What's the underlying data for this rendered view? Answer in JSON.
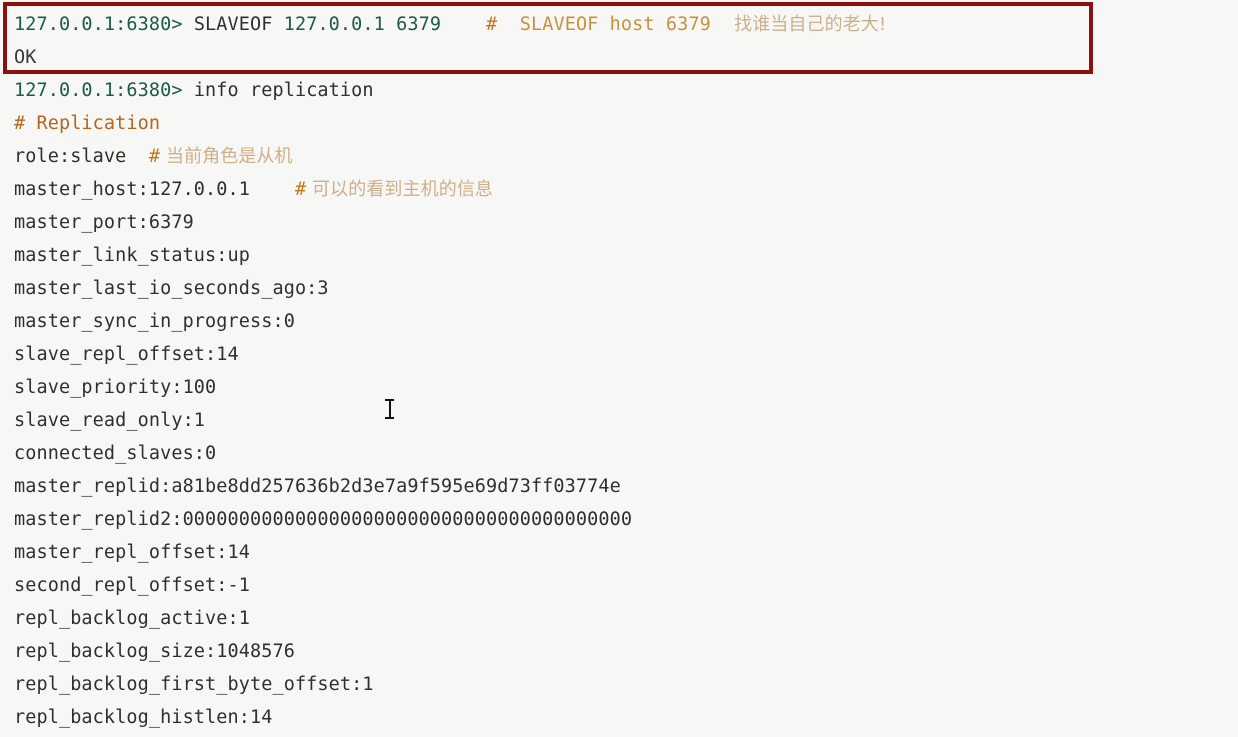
{
  "terminal": {
    "background_color": "#f7f7f5",
    "highlight_box_color": "#8b1111",
    "prompt_color": "#1d5c43",
    "comment_color": "#c8913f",
    "section_color": "#b5651d",
    "cursor_icon": "i-beam-text-cursor"
  },
  "highlighted_block": {
    "command_line": {
      "prompt": "127.0.0.1:6380>",
      "command": " SLAVEOF ",
      "args": "127.0.0.1 6379",
      "gap": "    ",
      "comment_hash": "#",
      "comment_en": "  SLAVEOF host 6379",
      "comment_cn": "    找谁当自己的老大!"
    },
    "reply": "OK"
  },
  "info_command": {
    "prompt": "127.0.0.1:6380>",
    "command": " info replication"
  },
  "section_header": "# Replication",
  "info_lines": [
    {
      "text": "role:slave",
      "gap": "  ",
      "hash": "#",
      "comment_cn": " 当前角色是从机"
    },
    {
      "text": "master_host:127.0.0.1",
      "gap": "    ",
      "hash": "#",
      "comment_cn": " 可以的看到主机的信息"
    },
    {
      "text": "master_port:6379"
    },
    {
      "text": "master_link_status:up"
    },
    {
      "text": "master_last_io_seconds_ago:3"
    },
    {
      "text": "master_sync_in_progress:0"
    },
    {
      "text": "slave_repl_offset:14"
    },
    {
      "text": "slave_priority:100"
    },
    {
      "text": "slave_read_only:1"
    },
    {
      "text": "connected_slaves:0"
    },
    {
      "text": "master_replid:a81be8dd257636b2d3e7a9f595e69d73ff03774e"
    },
    {
      "text": "master_replid2:0000000000000000000000000000000000000000"
    },
    {
      "text": "master_repl_offset:14"
    },
    {
      "text": "second_repl_offset:-1"
    },
    {
      "text": "repl_backlog_active:1"
    },
    {
      "text": "repl_backlog_size:1048576"
    },
    {
      "text": "repl_backlog_first_byte_offset:1"
    },
    {
      "text": "repl_backlog_histlen:14"
    }
  ]
}
